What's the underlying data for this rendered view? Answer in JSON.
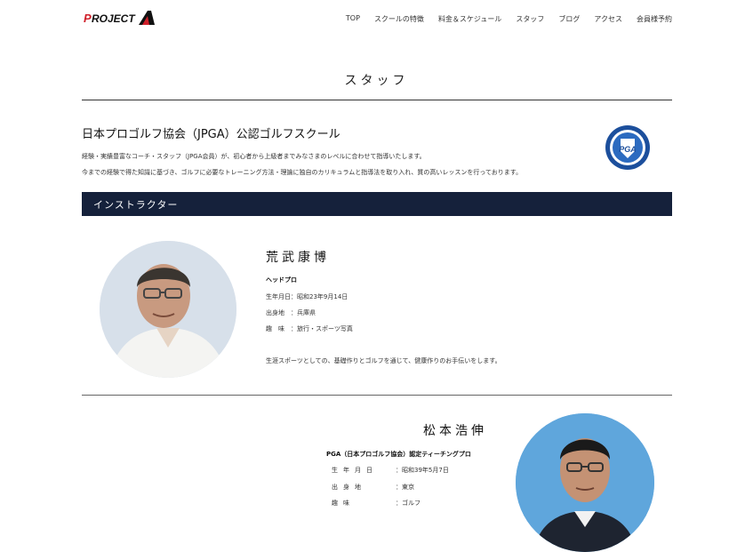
{
  "header": {
    "logo_text": "PROJECT A",
    "nav": [
      "TOP",
      "スクールの特徴",
      "料金＆スケジュール",
      "スタッフ",
      "ブログ",
      "アクセス",
      "会員様予約"
    ]
  },
  "page": {
    "title": "スタッフ"
  },
  "intro": {
    "heading": "日本プロゴルフ協会（JPGA）公認ゴルフスクール",
    "p1": "経験・実績豊富なコーチ・スタッフ（JPGA会員）が、初心者から上級者までみなさまのレベルに合わせて指導いたします。",
    "p2": "今までの経験で得た知識に基づき、ゴルフに必要なトレーニング方法・理論に独自のカリキュラムと指導法を取り入れ、質の高いレッスンを行っております。",
    "badge_text": "PGA"
  },
  "section": {
    "instructor_label": "インストラクター"
  },
  "staff1": {
    "name": "荒武康博",
    "role": "ヘッドプロ",
    "birth": "生年月日：昭和23年9月14日",
    "origin": "出身地　：兵庫県",
    "hobby": "趣　味　：旅行・スポーツ写真",
    "desc": "生涯スポーツとしての、基礎作りとゴルフを通じて、健康作りのお手伝いをします。"
  },
  "staff2": {
    "name": "松本浩伸",
    "role": "PGA（日本プロゴルフ協会）認定ティーチングプロ",
    "rows": [
      {
        "k": "生年月日",
        "v": "：昭和39年5月7日"
      },
      {
        "k": "出身地",
        "v": "：東京"
      },
      {
        "k": "趣味",
        "v": "：ゴルフ"
      }
    ]
  },
  "colors": {
    "section_bar": "#15213b",
    "logo_red": "#d0202a"
  }
}
